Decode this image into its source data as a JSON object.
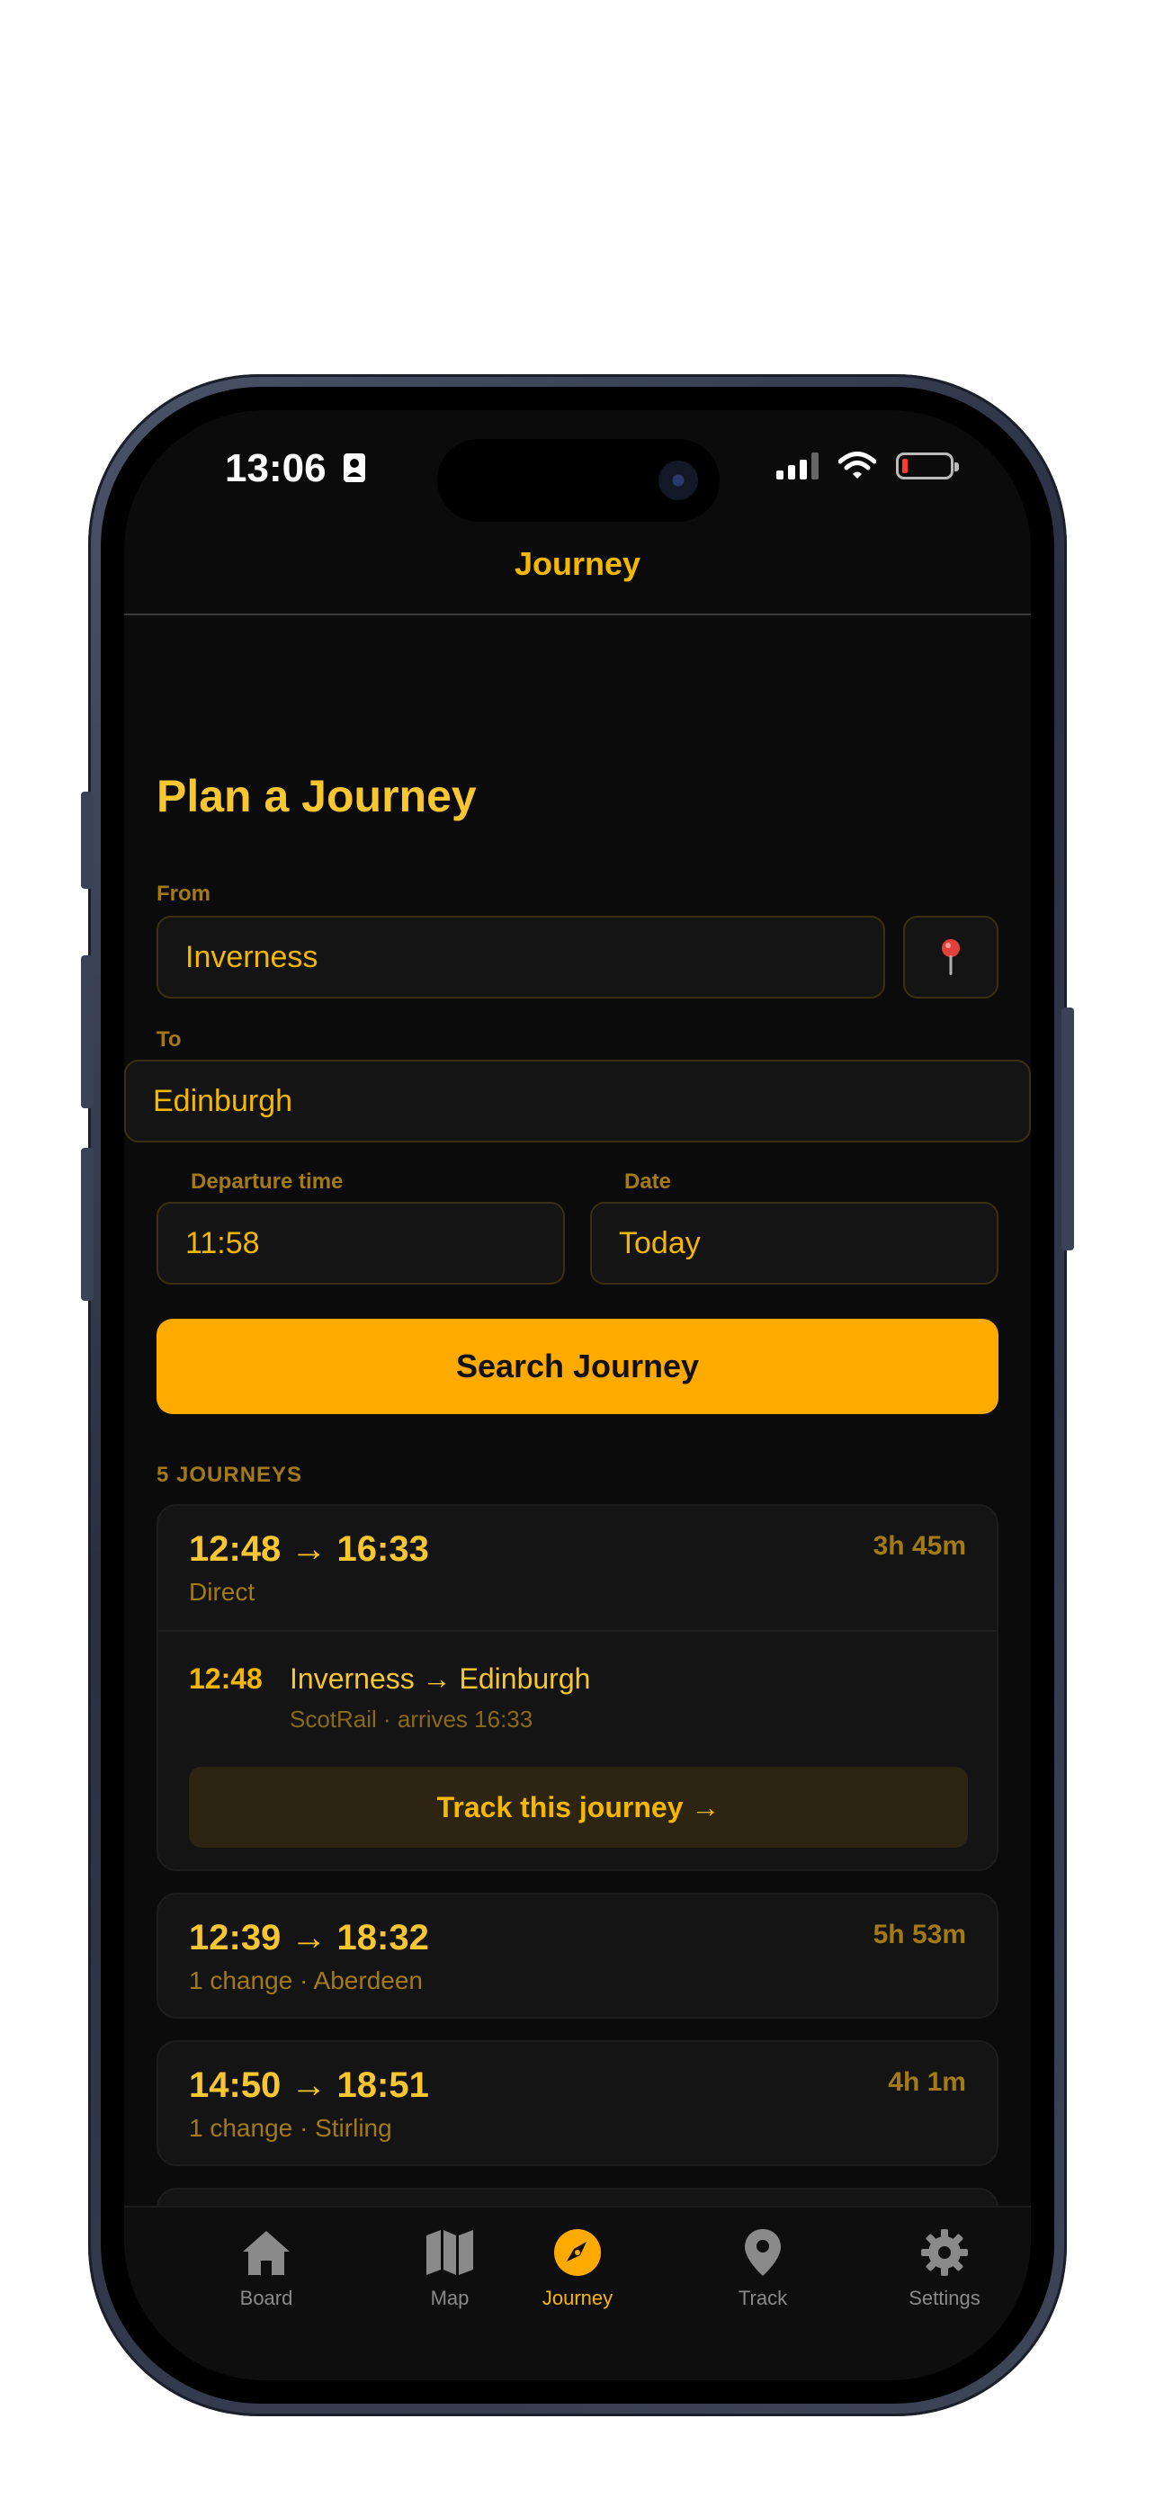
{
  "status_bar": {
    "time": "13:06"
  },
  "nav": {
    "title": "Journey"
  },
  "plan": {
    "heading": "Plan a Journey",
    "from_label": "From",
    "from_value": "Inverness",
    "to_label": "To",
    "to_value": "Edinburgh",
    "departure_label": "Departure time",
    "departure_value": "11:58",
    "date_label": "Date",
    "date_value": "Today",
    "search_label": "Search Journey"
  },
  "results": {
    "count_label": "5 JOURNEYS",
    "journeys": [
      {
        "times": "12:48 → 16:33",
        "summary": "Direct",
        "duration": "3h 45m",
        "leg": {
          "time": "12:48",
          "route": "Inverness → Edinburgh",
          "operator": "ScotRail · arrives 16:33"
        },
        "track_label": "Track this journey →"
      },
      {
        "times": "12:39 → 18:32",
        "summary": "1 change · Aberdeen",
        "duration": "5h 53m"
      },
      {
        "times": "14:50 → 18:51",
        "summary": "1 change · Stirling",
        "duration": "4h 1m"
      }
    ]
  },
  "tabs": [
    {
      "label": "Board",
      "icon": "home-icon"
    },
    {
      "label": "Map",
      "icon": "map-icon"
    },
    {
      "label": "Journey",
      "icon": "compass-icon",
      "active": true
    },
    {
      "label": "Track",
      "icon": "location-pin-icon"
    },
    {
      "label": "Settings",
      "icon": "gear-icon"
    }
  ],
  "colors": {
    "accent": "#ffaa00",
    "text_accent": "#f7c631",
    "muted": "#a27a16",
    "background": "#0b0b0b"
  }
}
